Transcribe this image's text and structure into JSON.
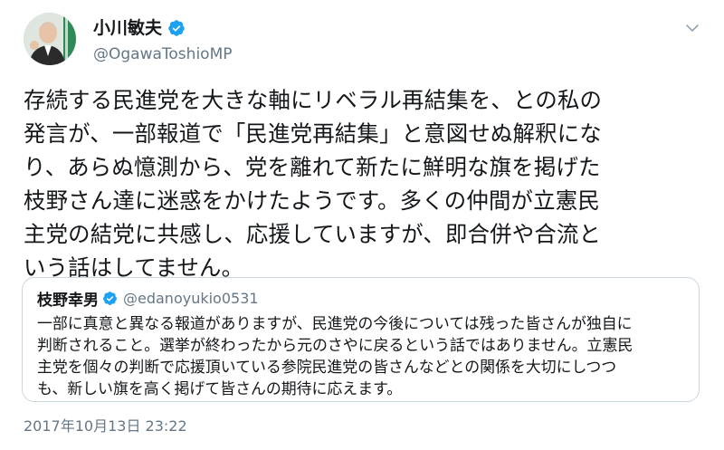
{
  "author": {
    "display_name": "小川敏夫",
    "handle": "@OgawaToshioMP",
    "verified": true
  },
  "tweet": {
    "text": "存続する民進党を大きな軸にリベラル再結集を、との私の\n発言が、一部報道で「民進党再結集」と意図せぬ解釈にな\nり、あらぬ憶測から、党を離れて新たに鮮明な旗を掲げた\n枝野さん達に迷惑をかけたようです。多くの仲間が立憲民\n主党の結党に共感し、応援していますが、即合併や合流と\nいう話はしてません。",
    "timestamp": "2017年10月13日 23:22"
  },
  "quoted_tweet": {
    "display_name": "枝野幸男",
    "handle": "@edanoyukio0531",
    "verified": true,
    "text": "一部に真意と異なる報道がありますが、民進党の今後については残った皆さんが独自に\n判断されること。選挙が終わったから元のさやに戻るという話ではありません。立憲民\n主党を個々の判断で応援頂いている参院民進党の皆さんなどとの関係を大切にしつつ\nも、新しい旗を高く掲げて皆さんの期待に応えます。"
  },
  "colors": {
    "verified_blue": "#1da1f2",
    "secondary_text": "#657786",
    "border": "#ccd6dd"
  },
  "icons": {
    "verified": "verified-badge-icon",
    "caret": "chevron-down-icon"
  }
}
